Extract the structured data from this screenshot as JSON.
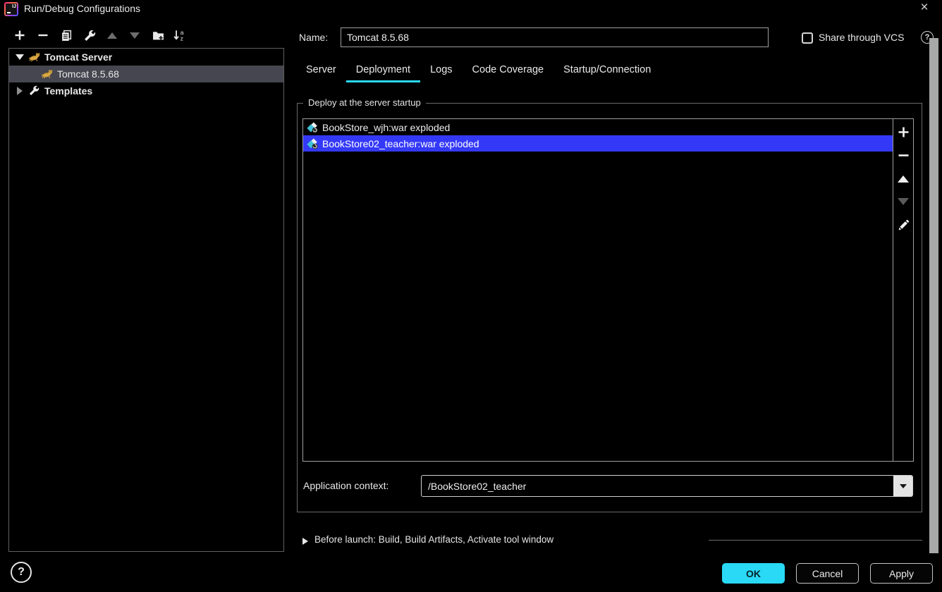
{
  "window": {
    "title": "Run/Debug Configurations",
    "close_glyph": "×",
    "logo_text": "IJ"
  },
  "toolbar": {
    "icons": [
      "add",
      "remove",
      "copy",
      "edit-defaults",
      "move-up",
      "move-down",
      "new-folder",
      "sort-alphabetically"
    ],
    "sort_a": "a",
    "sort_z": "z"
  },
  "tree": {
    "items": [
      {
        "label": "Tomcat Server",
        "expanded": true,
        "bold": true
      },
      {
        "label": "Tomcat 8.5.68",
        "selected": true
      },
      {
        "label": "Templates",
        "expanded": false,
        "bold": true
      }
    ]
  },
  "header": {
    "name_label": "Name:",
    "name_value": "Tomcat 8.5.68",
    "share_vcs_label": "Share through VCS",
    "share_vcs_checked": false,
    "help_glyph": "?"
  },
  "tabs": [
    {
      "label": "Server"
    },
    {
      "label": "Deployment",
      "active": true
    },
    {
      "label": "Logs"
    },
    {
      "label": "Code Coverage"
    },
    {
      "label": "Startup/Connection"
    }
  ],
  "deploy": {
    "group_title": "Deploy at the server startup",
    "items": [
      {
        "label": "BookStore_wjh:war exploded"
      },
      {
        "label": "BookStore02_teacher:war exploded",
        "selected": true
      }
    ],
    "list_actions": [
      "add",
      "remove",
      "move-up",
      "move-down",
      "edit"
    ],
    "app_context_label": "Application context:",
    "app_context_value": "/BookStore02_teacher"
  },
  "before_launch": {
    "label": "Before launch: Build, Build Artifacts, Activate tool window"
  },
  "footer": {
    "help_glyph": "?",
    "ok": "OK",
    "cancel": "Cancel",
    "apply": "Apply"
  },
  "colors": {
    "accent": "#29D9F5",
    "selection": "#3439F7",
    "tree_selection": "#45464F",
    "artifact_cyan": "#3FC1D8",
    "tomcat_gold": "#D9A741",
    "scrollbar": "#A8A8A8"
  }
}
